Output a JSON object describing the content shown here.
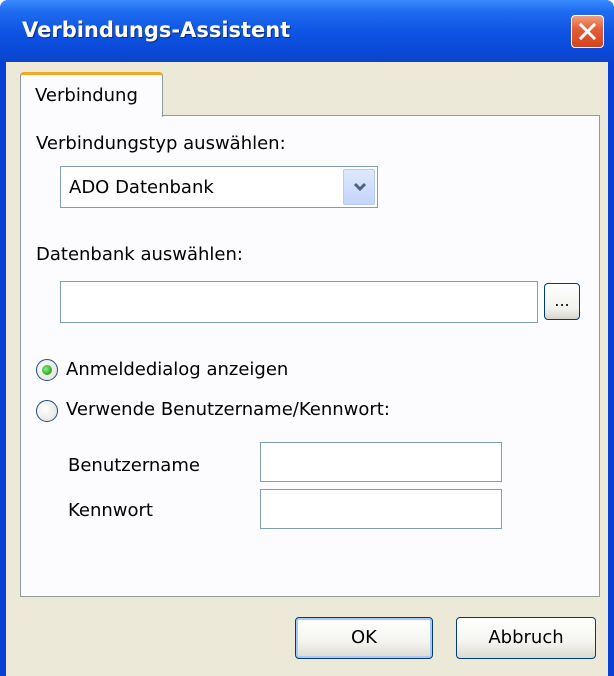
{
  "window": {
    "title": "Verbindungs-Assistent",
    "close_icon": "close-icon"
  },
  "tabs": [
    {
      "label": "Verbindung",
      "selected": true
    }
  ],
  "connection_type": {
    "label": "Verbindungstyp auswählen:",
    "selected_value": "ADO Datenbank",
    "dropdown_icon": "chevron-down-icon"
  },
  "database": {
    "label": "Datenbank auswählen:",
    "value": "",
    "browse_label": "..."
  },
  "auth": {
    "options": [
      {
        "label": "Anmeldedialog anzeigen",
        "checked": true
      },
      {
        "label": "Verwende Benutzername/Kennwort:",
        "checked": false
      }
    ],
    "username_label": "Benutzername",
    "username_value": "",
    "password_label": "Kennwort",
    "password_value": ""
  },
  "buttons": {
    "ok_label": "OK",
    "cancel_label": "Abbruch"
  },
  "colors": {
    "titlebar": "#0a48d6",
    "close_button": "#d4431d",
    "tab_accent": "#f5a623",
    "dialog_background": "#ece9d8",
    "radio_checked": "#2db52a"
  }
}
